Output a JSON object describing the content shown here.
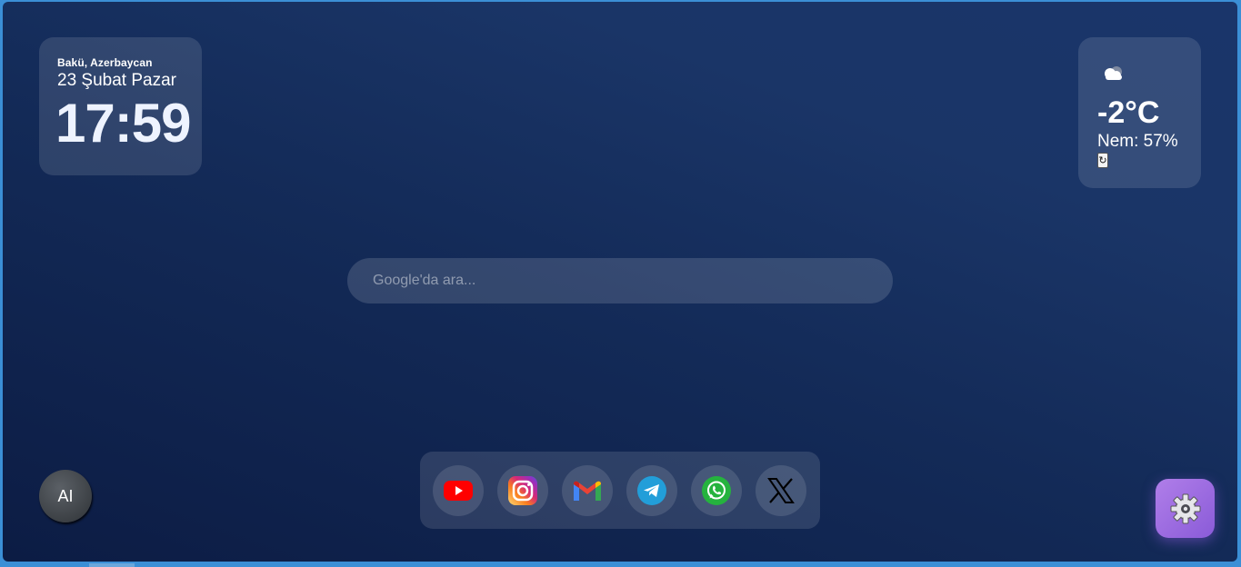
{
  "clock": {
    "location": "Bakü, Azerbaycan",
    "date": "23 Şubat Pazar",
    "time": "17:59"
  },
  "weather": {
    "icon": "cloud-icon",
    "temperature": "-2°C",
    "humidity": "Nem: 57%",
    "refresh_symbol": "↻"
  },
  "search": {
    "placeholder": "Google'da ara..."
  },
  "dock": {
    "apps": [
      {
        "name": "YouTube",
        "icon": "youtube-icon",
        "color": "#ff0000"
      },
      {
        "name": "Instagram",
        "icon": "instagram-icon",
        "color": "#e1306c"
      },
      {
        "name": "Gmail",
        "icon": "gmail-icon",
        "color": "#ea4335"
      },
      {
        "name": "Telegram",
        "icon": "telegram-icon",
        "color": "#229ed9"
      },
      {
        "name": "WhatsApp",
        "icon": "whatsapp-icon",
        "color": "#25d366"
      },
      {
        "name": "X",
        "icon": "x-icon",
        "color": "#000000"
      }
    ]
  },
  "ai_button": {
    "label": "AI"
  },
  "settings": {
    "icon": "gear-icon",
    "accent": "#9b6ce0"
  }
}
